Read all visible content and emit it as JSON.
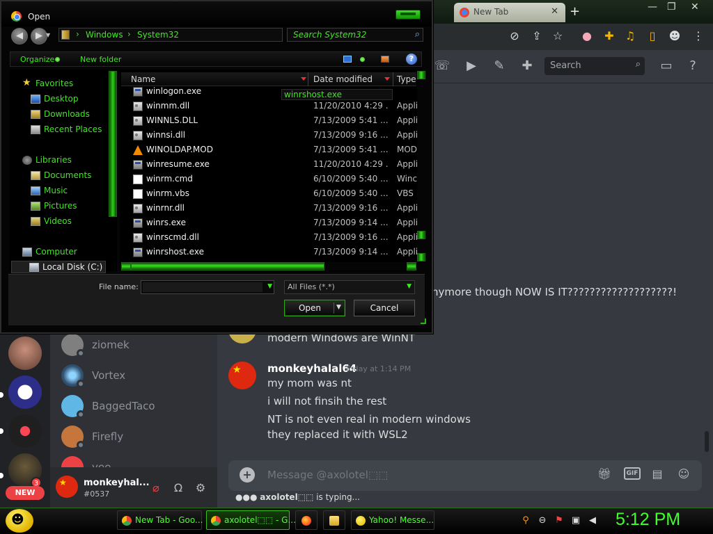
{
  "browser": {
    "tab_title": "New Tab",
    "address_icons": [
      "close-tab-icon",
      "share-icon",
      "bookmark-star-icon",
      "extension-flag-icon",
      "extension-puzzle-icon",
      "media-icon",
      "sidebar-icon",
      "profile-icon",
      "more-icon"
    ]
  },
  "discord": {
    "search_placeholder": "Search",
    "dm_list": [
      {
        "name": "ziomek",
        "color": "#7f7f7f"
      },
      {
        "name": "Vortex",
        "color": "#3d6b8f"
      },
      {
        "name": "BaggedTaco",
        "color": "#5fb7e5"
      },
      {
        "name": "Firefly",
        "color": "#c5763c"
      },
      {
        "name": "yee",
        "color": "#ed4245"
      }
    ],
    "user_panel": {
      "name": "monkeyhal...",
      "tag": "#0537"
    },
    "new_badge": "NEW",
    "mention_count": "3",
    "messages": {
      "partial_line": "nymore though NOW IS IT???????????????????!",
      "prev_line": "modern Windows are WinNT",
      "author": "monkeyhalal64",
      "timestamp": "Today at 1:14 PM",
      "lines": [
        "my mom was nt",
        "i will not finsih the rest",
        "NT is not even real in modern windows",
        "they replaced it with WSL2"
      ]
    },
    "composer_placeholder": "Message @axolotel⬚⬚",
    "typing_user": "axolotel⬚⬚",
    "typing_suffix": " is typing..."
  },
  "taskbar": {
    "buttons": [
      {
        "label": "New Tab - Goo...",
        "icon": "chrome-icon",
        "active": false
      },
      {
        "label": "axolotel⬚⬚ - G...",
        "icon": "chrome-icon",
        "active": true
      },
      {
        "label": "",
        "icon": "firefox-icon",
        "active": false
      },
      {
        "label": "",
        "icon": "folder-icon",
        "active": false
      },
      {
        "label": "Yahoo! Messe...",
        "icon": "yahoo-messenger-icon",
        "active": false
      }
    ],
    "clock": "5:12 PM"
  },
  "dialog": {
    "title": "Open",
    "breadcrumb": [
      "Windows",
      "System32"
    ],
    "search_placeholder": "Search System32",
    "toolbar": {
      "organize": "Organize",
      "new_folder": "New folder"
    },
    "nav": {
      "favorites": "Favorites",
      "desktop": "Desktop",
      "downloads": "Downloads",
      "recent": "Recent Places",
      "libraries": "Libraries",
      "documents": "Documents",
      "music": "Music",
      "pictures": "Pictures",
      "videos": "Videos",
      "computer": "Computer",
      "local_disk": "Local Disk (C:)"
    },
    "columns": {
      "name": "Name",
      "date": "Date modified",
      "type": "Type"
    },
    "tooltip": "winrshost.exe",
    "files": [
      {
        "name": "winlogon.exe",
        "date": "",
        "type": "",
        "icon": "exe"
      },
      {
        "name": "winmm.dll",
        "date": "11/20/2010 4:29 ...",
        "type": "Appli",
        "icon": "dll"
      },
      {
        "name": "WINNLS.DLL",
        "date": "7/13/2009 5:41 ...",
        "type": "Appli",
        "icon": "dll"
      },
      {
        "name": "winnsi.dll",
        "date": "7/13/2009 9:16 ...",
        "type": "Appli",
        "icon": "dll"
      },
      {
        "name": "WINOLDAP.MOD",
        "date": "7/13/2009 5:41 ...",
        "type": "MOD",
        "icon": "cone"
      },
      {
        "name": "winresume.exe",
        "date": "11/20/2010 4:29 ...",
        "type": "Appli",
        "icon": "exe"
      },
      {
        "name": "winrm.cmd",
        "date": "6/10/2009 5:40 ...",
        "type": "Winc",
        "icon": "doc"
      },
      {
        "name": "winrm.vbs",
        "date": "6/10/2009 5:40 ...",
        "type": "VBS",
        "icon": "doc"
      },
      {
        "name": "winrnr.dll",
        "date": "7/13/2009 9:16 ...",
        "type": "Appli",
        "icon": "dll"
      },
      {
        "name": "winrs.exe",
        "date": "7/13/2009 9:14 ...",
        "type": "Appli",
        "icon": "exe"
      },
      {
        "name": "winrscmd.dll",
        "date": "7/13/2009 9:16 ...",
        "type": "Appli",
        "icon": "dll"
      },
      {
        "name": "winrshost.exe",
        "date": "7/13/2009 9:14 ...",
        "type": "Appli",
        "icon": "exe"
      }
    ],
    "file_name_label": "File name:",
    "file_name_value": "",
    "file_type": "All Files (*.*)",
    "open_label": "Open",
    "cancel_label": "Cancel"
  }
}
